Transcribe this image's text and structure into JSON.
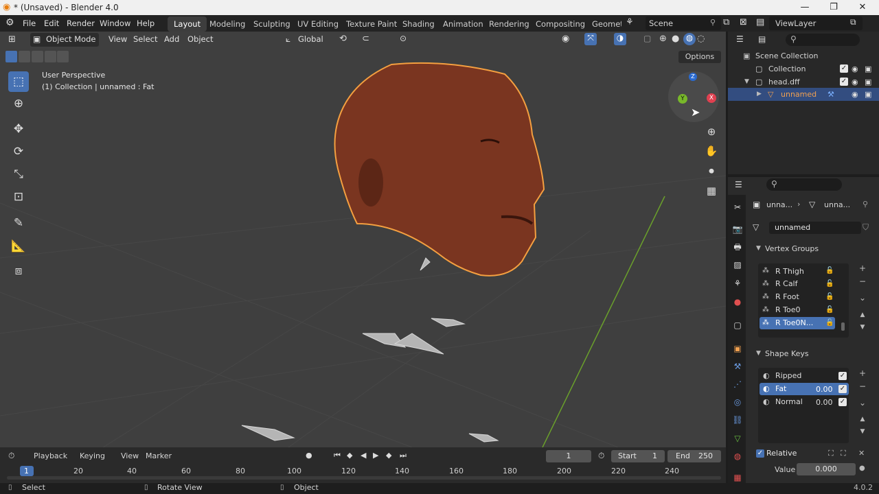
{
  "titlebar": {
    "title": "* (Unsaved) - Blender 4.0",
    "minimize": "—",
    "maximize": "❐",
    "close": "✕"
  },
  "menu": [
    "File",
    "Edit",
    "Render",
    "Window",
    "Help"
  ],
  "workspaces": [
    "Layout",
    "Modeling",
    "Sculpting",
    "UV Editing",
    "Texture Paint",
    "Shading",
    "Animation",
    "Rendering",
    "Compositing",
    "Geomet"
  ],
  "scene": {
    "label": "Scene",
    "viewlayer": "ViewLayer"
  },
  "viewport_header": {
    "mode": "Object Mode",
    "view": "View",
    "select": "Select",
    "add": "Add",
    "object": "Object",
    "orientation": "Global",
    "options": "Options"
  },
  "overlay": {
    "perspective": "User Perspective",
    "context": "(1) Collection | unnamed : Fat"
  },
  "gizmo": {
    "z": "Z",
    "y": "Y",
    "x": "X"
  },
  "outliner": {
    "root": "Scene Collection",
    "collection": "Collection",
    "file": "head.dff",
    "object": "unnamed"
  },
  "properties": {
    "breadcrumb_a": "unna...",
    "breadcrumb_b": "unna...",
    "mesh_name": "unnamed",
    "vertex_groups_title": "Vertex Groups",
    "vertex_groups": [
      "R Thigh",
      "R Calf",
      "R Foot",
      "R Toe0",
      "R Toe0N..."
    ],
    "shape_keys_title": "Shape Keys",
    "shape_keys": [
      {
        "name": "Ripped",
        "value": ""
      },
      {
        "name": "Fat",
        "value": "0.00"
      },
      {
        "name": "Normal",
        "value": "0.00"
      }
    ],
    "relative_label": "Relative",
    "value_label": "Value",
    "value": "0.000"
  },
  "timeline": {
    "playback": "Playback",
    "keying": "Keying",
    "view": "View",
    "marker": "Marker",
    "current_frame": "1",
    "start_label": "Start",
    "start": "1",
    "end_label": "End",
    "end": "250",
    "ruler": [
      "1",
      "20",
      "40",
      "60",
      "80",
      "100",
      "120",
      "140",
      "160",
      "180",
      "200",
      "220",
      "240"
    ]
  },
  "statusbar": {
    "select": "Select",
    "rotate": "Rotate View",
    "object": "Object",
    "version": "4.0.2"
  },
  "colors": {
    "accent": "#4772b3",
    "selection_outline": "#f5a040",
    "skin": "#7a3520",
    "grid_green": "#6aa02b"
  }
}
